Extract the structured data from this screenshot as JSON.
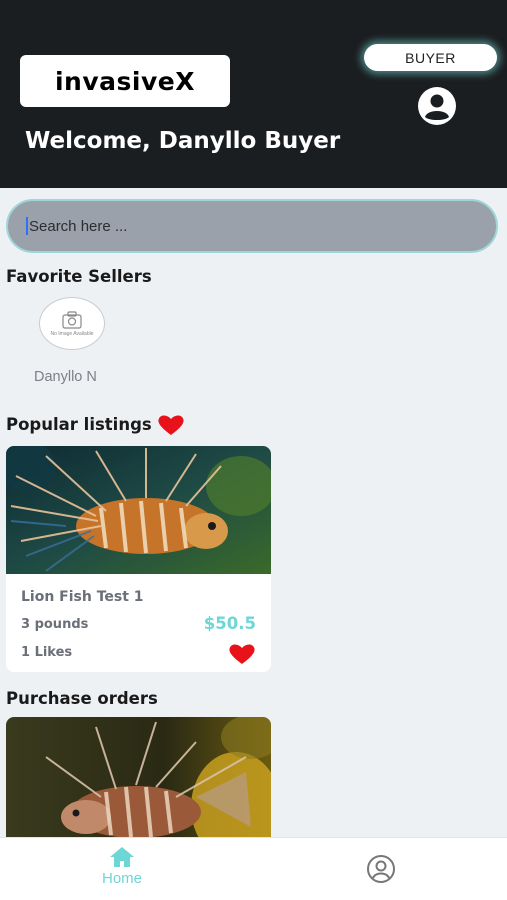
{
  "header": {
    "logo_text": "invasiveX",
    "role_badge": "BUYER",
    "welcome": "Welcome, Danyllo Buyer"
  },
  "search": {
    "placeholder": "Search here ..."
  },
  "favorite_sellers": {
    "title": "Favorite Sellers",
    "sellers": [
      {
        "name": "Danyllo N",
        "avatar_text": "No Image Available"
      }
    ]
  },
  "popular_listings": {
    "title": "Popular listings",
    "items": [
      {
        "title": "Lion Fish Test 1",
        "weight": "3 pounds",
        "price": "$50.5",
        "likes": "1 Likes"
      }
    ]
  },
  "purchase_orders": {
    "title": "Purchase orders"
  },
  "bottom_nav": {
    "home_label": "Home"
  },
  "colors": {
    "header_bg": "#1b1e20",
    "accent": "#6fd6d6",
    "heart": "#e8121b",
    "search_bg": "#9ba1aa"
  },
  "icons": [
    "user-circle-icon",
    "camera-icon",
    "heart-icon",
    "home-icon",
    "profile-outline-icon"
  ]
}
